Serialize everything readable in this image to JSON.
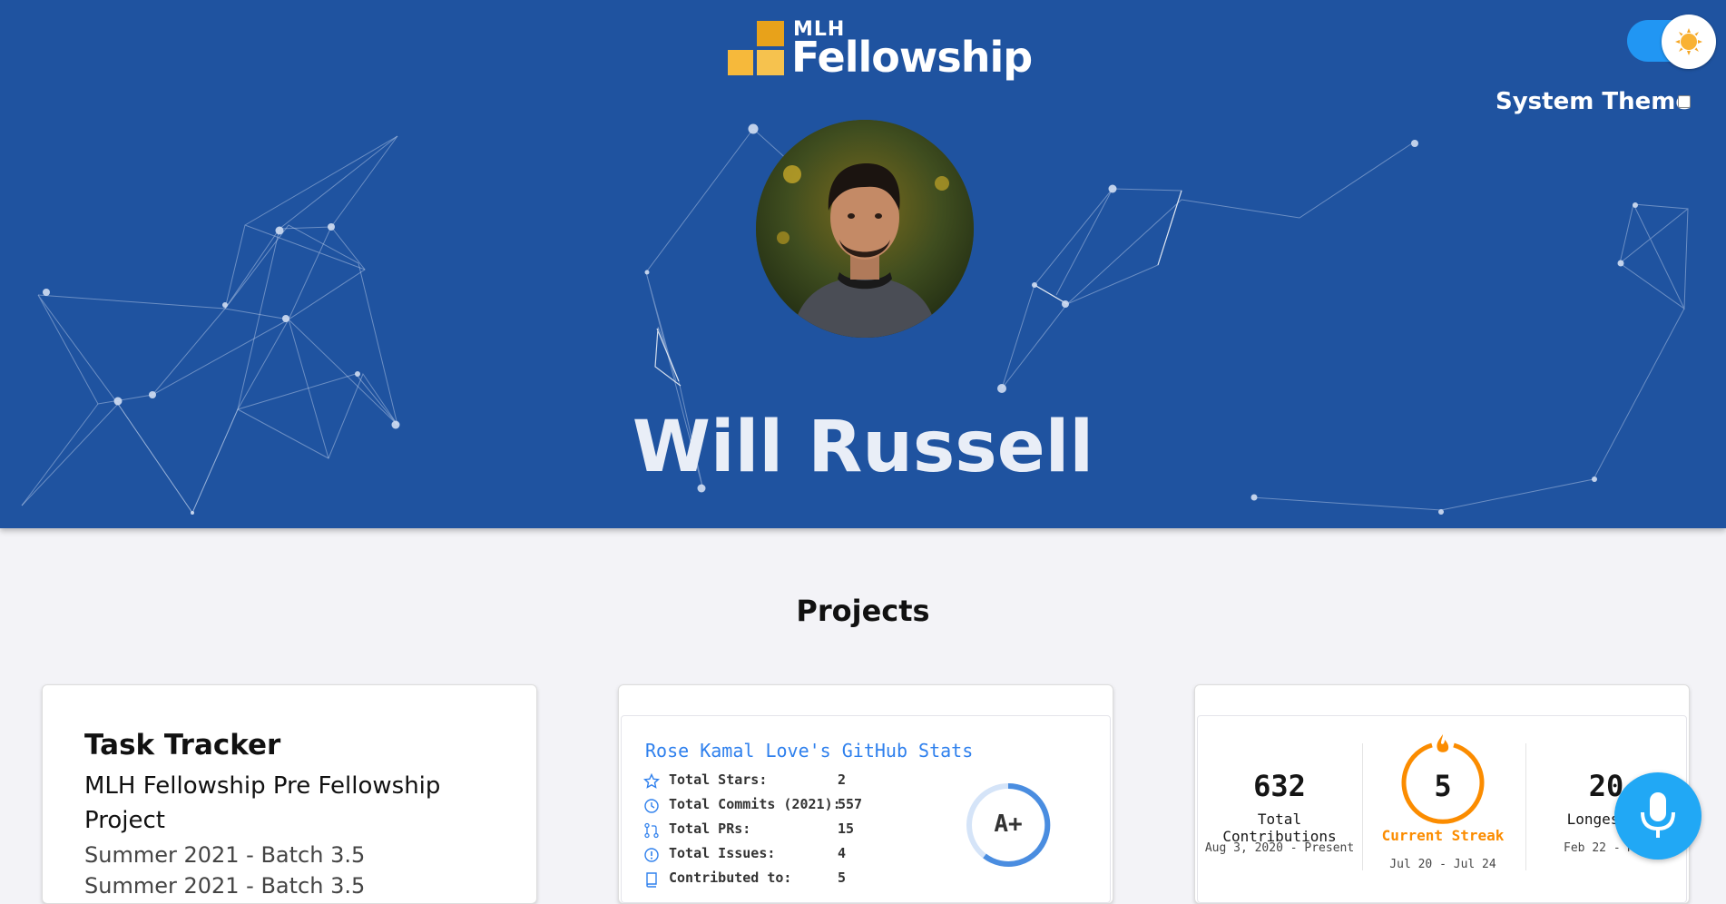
{
  "header": {
    "logo_small": "MLH",
    "logo_large": "Fellowship",
    "system_theme_label": "System Theme",
    "profile_name": "Will Russell"
  },
  "projects": {
    "section_title": "Projects",
    "task_tracker": {
      "title": "Task Tracker",
      "subtitle": "MLH Fellowship Pre Fellowship Project",
      "batch_1": "Summer 2021 - Batch 3.5",
      "batch_2": "Summer 2021 - Batch 3.5"
    },
    "github_stats": {
      "title": "Rose Kamal Love's GitHub Stats",
      "rows": [
        {
          "label": "Total Stars:",
          "value": "2"
        },
        {
          "label": "Total Commits (2021):",
          "value": "557"
        },
        {
          "label": "Total PRs:",
          "value": "15"
        },
        {
          "label": "Total Issues:",
          "value": "4"
        },
        {
          "label": "Contributed to:",
          "value": "5"
        }
      ],
      "grade": "A+"
    },
    "streak": {
      "total": {
        "value": "632",
        "label": "Total Contributions",
        "range": "Aug 3, 2020 - Present"
      },
      "current": {
        "value": "5",
        "label": "Current Streak",
        "range": "Jul 20 - Jul 24"
      },
      "longest": {
        "value": "20",
        "label": "Longest S",
        "range": "Feb 22 - Mar"
      }
    }
  },
  "colors": {
    "hero_bg": "#1f53a0",
    "accent_blue": "#2f80ed",
    "streak_orange": "#fb8c00",
    "toggle_blue": "#2196f3",
    "mic_blue": "#21a8f5"
  }
}
